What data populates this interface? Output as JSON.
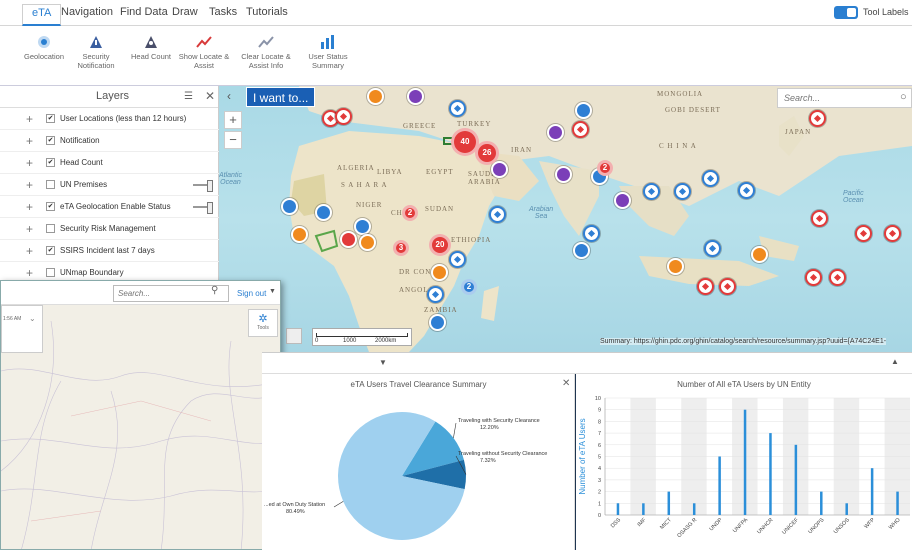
{
  "tabs": [
    "eTA",
    "Navigation",
    "Find Data",
    "Draw",
    "Tasks",
    "Tutorials"
  ],
  "tool_labels": "Tool Labels",
  "ribbon": [
    {
      "label": "Geolocation",
      "icon": "geolocation-icon"
    },
    {
      "label": "Security\nNotification",
      "icon": "security-notification-icon"
    },
    {
      "label": "Head Count",
      "icon": "head-count-icon"
    },
    {
      "label": "Show Locate &\nAssist",
      "icon": "locate-assist-icon"
    },
    {
      "label": "Clear Locate &\nAssist Info",
      "icon": "clear-locate-icon"
    },
    {
      "label": "User Status\nSummary",
      "icon": "user-status-icon"
    }
  ],
  "layers": {
    "title": "Layers",
    "items": [
      {
        "label": "User Locations (less than 12 hours)",
        "checked": true
      },
      {
        "label": "Notification",
        "checked": true
      },
      {
        "label": "Head Count",
        "checked": true
      },
      {
        "label": "UN Premises",
        "checked": false
      },
      {
        "label": "eTA Geolocation Enable Status",
        "checked": true
      },
      {
        "label": "Security Risk Management",
        "checked": false
      },
      {
        "label": "SSIRS Incident last 7 days",
        "checked": true
      },
      {
        "label": "UNmap Boundary",
        "checked": false
      }
    ]
  },
  "map": {
    "i_want_to": "I want to...",
    "search_placeholder": "Search...",
    "labels": {
      "mongolia": "MONGOLIA",
      "gobi": "GOBI DESERT",
      "china": "C H I N A",
      "japan": "JAPAN",
      "turkey": "TURKEY",
      "greece": "GREECE",
      "iran": "IRAN",
      "algeria": "ALGERIA",
      "libya": "LIBYA",
      "egypt": "EGYPT",
      "saudi": "SAUDI\nARABIA",
      "sahara": "S A H A R A",
      "niger": "NIGER",
      "chad": "CHAD",
      "sudan": "SUDAN",
      "ethiopia": "ETHIOPIA",
      "drc": "DR CONGO",
      "angola": "ANGOLA",
      "zambia": "ZAMBIA",
      "arabian_sea": "Arabian\nSea",
      "pacific": "Pacific\nOcean",
      "atlantic": "Atlantic\nOcean"
    },
    "clusters": [
      {
        "count": "40",
        "color": "#e23a3a"
      },
      {
        "count": "26",
        "color": "#e23a3a"
      },
      {
        "count": "20",
        "color": "#e23a3a"
      },
      {
        "count": "2",
        "color": "#e23a3a"
      },
      {
        "count": "3",
        "color": "#e23a3a"
      },
      {
        "count": "2",
        "color": "#2f7fd4"
      },
      {
        "count": "2",
        "color": "#e23a3a"
      }
    ],
    "scale": {
      "zero": "0",
      "mid": "1000",
      "end": "2000km"
    },
    "attribution": "Summary: https://ghin.pdc.org/ghin/catalog/search/resource/summary.jsp?uuid={A74C24E1-"
  },
  "overlay": {
    "search_placeholder": "Search...",
    "sign_out": "Sign out",
    "tools": "Tools",
    "time": "1:56 AM"
  },
  "pie_chart_title": "eTA Users Travel Clearance Summary",
  "bar_chart_title": "Number of All eTA Users by UN Entity",
  "chart_data": [
    {
      "type": "pie",
      "title": "eTA Users Travel Clearance Summary",
      "slices": [
        {
          "label": "Traveling with Security Clearance",
          "pct_label": "12.20%",
          "value": 12.2,
          "color": "#4aa7d9"
        },
        {
          "label": "Traveling without Security Clearance",
          "pct_label": "7.32%",
          "value": 7.32,
          "color": "#1f6fa8"
        },
        {
          "label": "...ed at Own Duty Station",
          "pct_label": "80.49%",
          "value": 80.49,
          "color": "#9fd0ef"
        }
      ]
    },
    {
      "type": "bar",
      "title": "Number of All eTA Users by UN Entity",
      "ylabel": "Number of eTA Users",
      "ylim": [
        0,
        10
      ],
      "yticks": [
        "0",
        "1",
        "2",
        "3",
        "4",
        "5",
        "6",
        "7",
        "8",
        "9",
        "10"
      ],
      "categories": [
        "DSS",
        "IMF",
        "MICT",
        "OSASG R",
        "UNDP",
        "UNFPA",
        "UNHCR",
        "UNICEF",
        "UNOPS",
        "UNSOS",
        "WFP",
        "WHO"
      ],
      "values": [
        1,
        1,
        2,
        1,
        5,
        9,
        7,
        6,
        2,
        1,
        4,
        2
      ],
      "color": "#2b8fd9"
    }
  ]
}
